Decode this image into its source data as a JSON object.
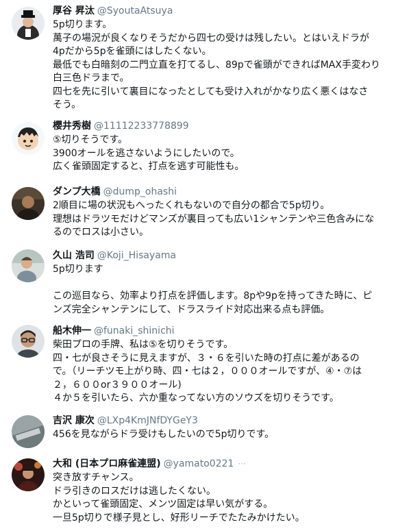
{
  "posts": [
    {
      "name": "厚谷 昇汰",
      "handle": "@SyoutaAtsuya",
      "avatar": "avatar-man-hat",
      "lines": [
        "5p切ります。",
        "萬子の場況が良くなりそうだから四七の受けは残したい。とはいえドラが",
        "4pだから5pを雀頭にはしたくない。",
        "最低でも白暗刻の二門立直を打てるし、89pで雀頭ができればMAX手変わり",
        "白三色ドラまで。",
        "四七を先に引いて裏目になったとしても受け入れがかなり広く悪くはなさ",
        "そう。"
      ]
    },
    {
      "name": "櫻井秀樹",
      "handle": "@11112233778899",
      "avatar": "avatar-cartoon",
      "lines": [
        "⑤切りそうです。",
        "3900オールを逃さないようにしたいので。",
        "広く雀頭固定すると、打点を逃す可能性も。"
      ]
    },
    {
      "name": "ダンプ大橋",
      "handle": "@dump_ohashi",
      "avatar": "avatar-dark-photo",
      "lines": [
        "2順目に場の状況もへったくれもないので自分の都合で5p切り。",
        "理想はドラツモだけどマンズが裏目っても広い1シャンテンや三色含みにな",
        "るのでロスは小さい。"
      ]
    },
    {
      "name": "久山 浩司",
      "handle": "@Koji_Hisayama",
      "avatar": "avatar-light-photo",
      "lines": [
        "5p切ります",
        "",
        "この巡目なら、効率より打点を評価します。8pや9pを持ってきた時に、ピ",
        "ンズ完全シャンテンにして、ドラスライド対応出来る点も評価。"
      ]
    },
    {
      "name": "船木伸一",
      "handle": "@funaki_shinichi",
      "avatar": "avatar-glasses",
      "lines": [
        "柴田プロの手牌、私は⑤を切りそうです。",
        "四・七が良さそうに見えますが、３・６を引いた時の打点に差があるの",
        "で。（リーチツモ上がり時、四・七は２，０００オールですが、④・⑦は",
        "２，６００or３９００オール)",
        "４か５を引いたら、六か重なってない方のソウズを切りそうです。"
      ]
    },
    {
      "name": "吉沢 康次",
      "handle": "@LXp4KmJNfDYGeY3",
      "avatar": "avatar-table",
      "lines": [
        "456を見ながらドラ受けもしたいので5p切りです。"
      ]
    },
    {
      "name": "大和 (日本プロ麻雀連盟)",
      "handle": "@yamato0221",
      "avatar": "avatar-stage",
      "dots": "···",
      "lines": [
        "突き放すチャンス。",
        "ドラ引きのロスだけは逃したくない。",
        "かといって雀頭固定、メンツ固定は早い気がする。",
        "一旦5p切りで様子見とし、好形リーチでたたみかけたい。"
      ]
    }
  ]
}
